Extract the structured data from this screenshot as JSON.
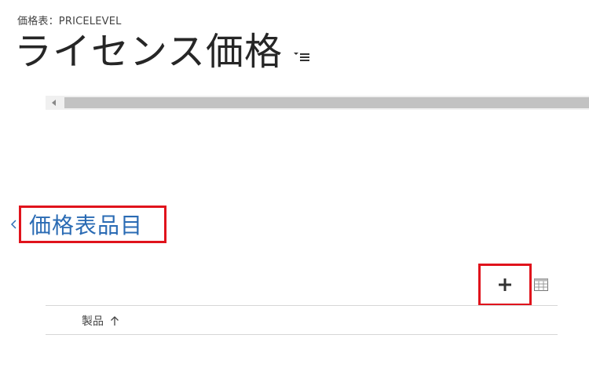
{
  "header": {
    "entity_label": "価格表：PRICELEVEL",
    "record_title": "ライセンス価格",
    "form_switcher_icon": "form-selector-icon"
  },
  "section": {
    "title": "価格表品目",
    "collapse_icon": "collapse-arrow-icon"
  },
  "subgrid": {
    "add_icon": "plus-icon",
    "view_icon": "grid-view-icon",
    "columns": [
      {
        "label": "製品",
        "sort_icon": "sort-ascending-icon"
      }
    ]
  },
  "colors": {
    "highlight": "#e0131c",
    "link": "#2a6bb4"
  }
}
